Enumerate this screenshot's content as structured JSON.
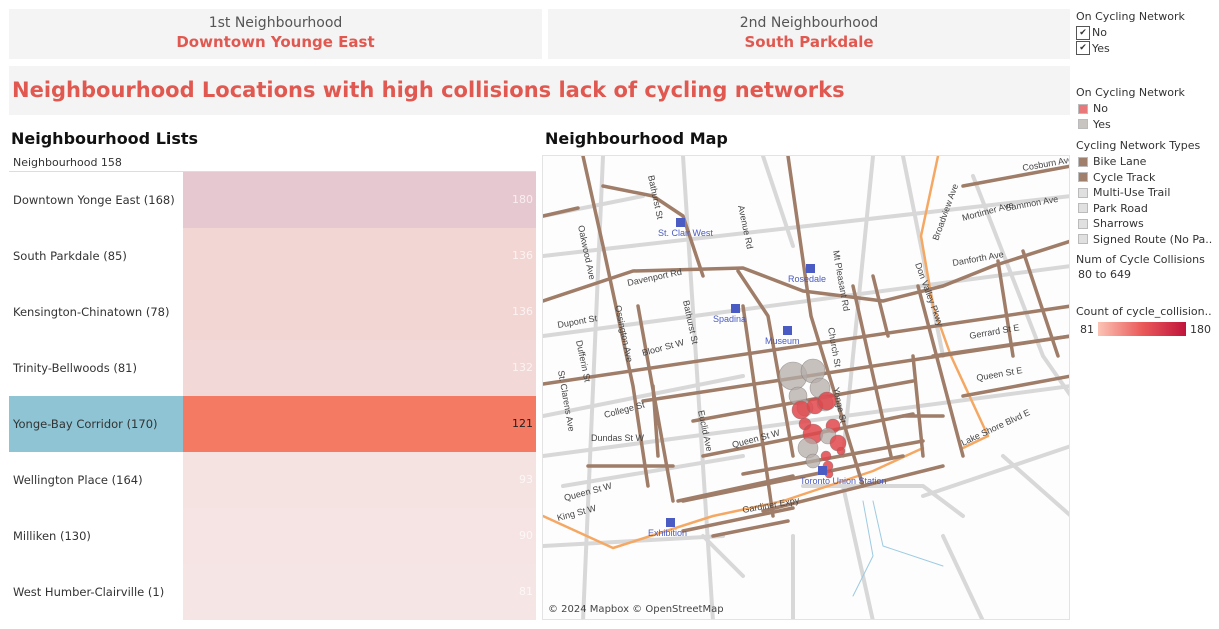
{
  "header": {
    "first": {
      "label": "1st Neighbourhood",
      "value": "Downtown Younge East"
    },
    "second": {
      "label": "2nd Neighbourhood",
      "value": "South Parkdale"
    }
  },
  "title": "Neighbourhood Locations with high collisions lack of cycling networks",
  "lists": {
    "title": "Neighbourhood Lists",
    "column_header": "Neighbourhood 158",
    "rows": [
      {
        "name": "Downtown Yonge East (168)",
        "value": 180,
        "color": "#e6c8d0"
      },
      {
        "name": "South Parkdale (85)",
        "value": 136,
        "color": "#f2d6d4"
      },
      {
        "name": "Kensington-Chinatown (78)",
        "value": 136,
        "color": "#f2d6d4"
      },
      {
        "name": "Trinity-Bellwoods (81)",
        "value": 132,
        "color": "#f2d8d6"
      },
      {
        "name": "Yonge-Bay Corridor (170)",
        "value": 121,
        "color": "#f47a63",
        "selected": true
      },
      {
        "name": "Wellington Place (164)",
        "value": 93,
        "color": "#f5e3e2"
      },
      {
        "name": "Milliken (130)",
        "value": 90,
        "color": "#f5e4e3"
      },
      {
        "name": "West Humber-Clairville (1)",
        "value": 81,
        "color": "#f5e6e5"
      }
    ]
  },
  "map": {
    "title": "Neighbourhood Map",
    "attribution": "© 2024 Mapbox © OpenStreetMap",
    "street_labels": [
      "Bathurst St",
      "Avenue Rd",
      "Oakwood Ave",
      "St. Clair West",
      "Davenport Rd",
      "Rosedale",
      "Mt Pleasant Rd",
      "Dupont St",
      "Ossington Ave",
      "Bathurst St",
      "Spadina",
      "Museum",
      "Church St",
      "Dufferin St",
      "Bloor St W",
      "St. Clarens Ave",
      "College St",
      "Yonge St",
      "Euclid Ave",
      "Dundas St W",
      "Queen St W",
      "Toronto Union Station",
      "Queen St W",
      "King St W",
      "Gardiner Expy",
      "Exhibition",
      "Broadview Ave",
      "Mortimer Ave",
      "Sammon Ave",
      "Danforth Ave",
      "Don Valley Pkwy",
      "Gerrard St E",
      "Queen St E",
      "Lake Shore Blvd E",
      "Cosburn Ave"
    ]
  },
  "legend": {
    "filter": {
      "title": "On Cycling Network",
      "items": [
        {
          "label": "No",
          "checked": true
        },
        {
          "label": "Yes",
          "checked": true
        }
      ]
    },
    "color": {
      "title": "On Cycling Network",
      "items": [
        {
          "label": "No",
          "color": "#e8787a"
        },
        {
          "label": "Yes",
          "color": "#c8c4c0"
        }
      ]
    },
    "types": {
      "title": "Cycling Network Types",
      "items": [
        {
          "label": "Bike Lane",
          "color": "#a0806c"
        },
        {
          "label": "Cycle Track",
          "color": "#a0806c"
        },
        {
          "label": "Multi-Use Trail",
          "color": "#e0e0e0"
        },
        {
          "label": "Park Road",
          "color": "#e0e0e0"
        },
        {
          "label": "Sharrows",
          "color": "#e0e0e0"
        },
        {
          "label": "Signed Route (No Pa..",
          "color": "#e0e0e0"
        }
      ]
    },
    "size": {
      "title": "Num of Cycle Collisions",
      "range": "80 to 649"
    },
    "gradient": {
      "title": "Count of cycle_collision..",
      "min": "81",
      "max": "180",
      "from": "#fbc3b5",
      "to": "#c0143c"
    }
  }
}
